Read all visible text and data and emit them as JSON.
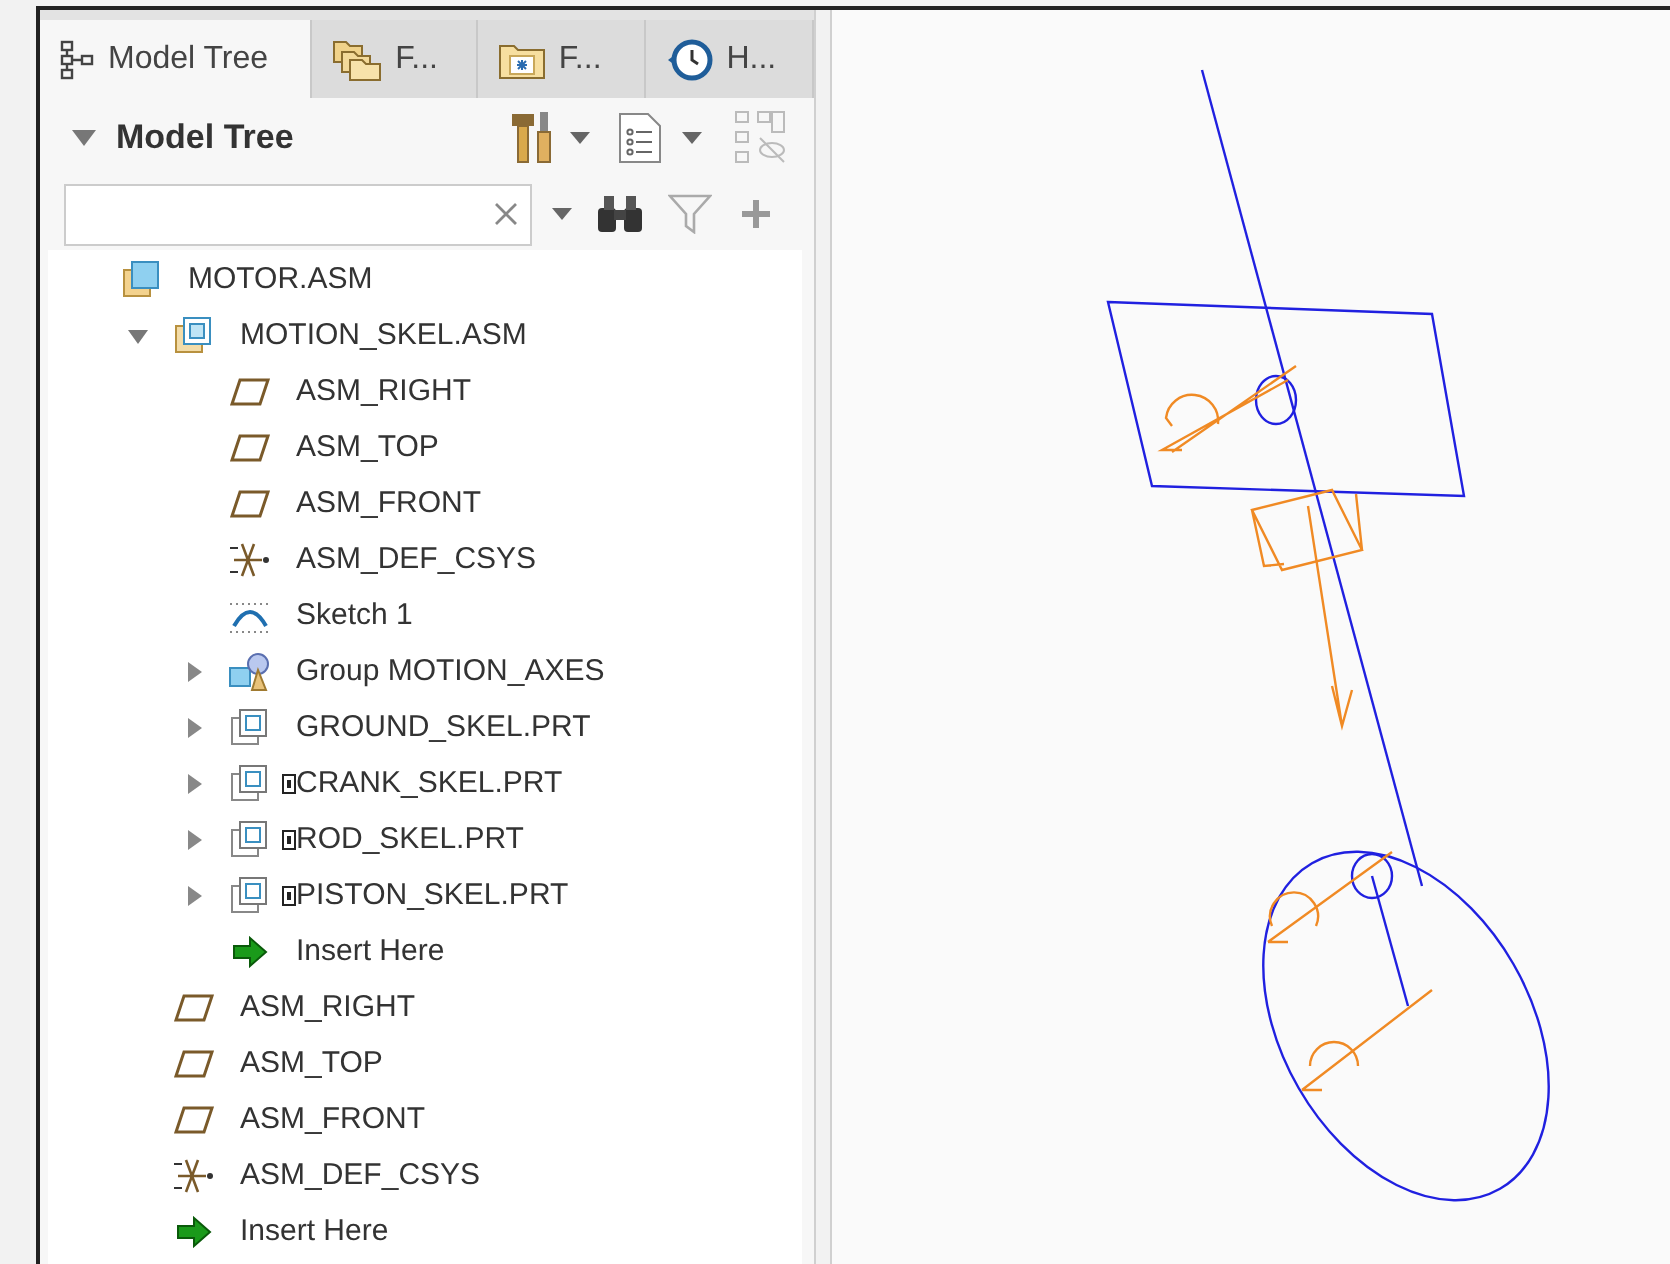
{
  "tabs": [
    {
      "label": "Model Tree",
      "kind": "tree",
      "selected": true
    },
    {
      "label": "F...",
      "kind": "folders",
      "selected": false
    },
    {
      "label": "F...",
      "kind": "favorites",
      "selected": false
    },
    {
      "label": "H...",
      "kind": "history",
      "selected": false
    }
  ],
  "panel": {
    "title": "Model Tree",
    "expanded": true
  },
  "tree": [
    {
      "label": "MOTOR.ASM",
      "kind": "assembly",
      "children": [
        {
          "label": "MOTION_SKEL.ASM",
          "kind": "skeleton",
          "expanded": true,
          "children": [
            {
              "label": "ASM_RIGHT",
              "kind": "plane"
            },
            {
              "label": "ASM_TOP",
              "kind": "plane"
            },
            {
              "label": "ASM_FRONT",
              "kind": "plane"
            },
            {
              "label": "ASM_DEF_CSYS",
              "kind": "csys"
            },
            {
              "label": "Sketch 1",
              "kind": "sketch"
            },
            {
              "label": "Group MOTION_AXES",
              "kind": "group",
              "expanded": false
            },
            {
              "label": "GROUND_SKEL.PRT",
              "kind": "part",
              "expanded": false,
              "flagged": false
            },
            {
              "label": "CRANK_SKEL.PRT",
              "kind": "part",
              "expanded": false,
              "flagged": true
            },
            {
              "label": "ROD_SKEL.PRT",
              "kind": "part",
              "expanded": false,
              "flagged": true
            },
            {
              "label": "PISTON_SKEL.PRT",
              "kind": "part",
              "expanded": false,
              "flagged": true
            },
            {
              "label": "Insert Here",
              "kind": "insert"
            }
          ]
        },
        {
          "label": "ASM_RIGHT",
          "kind": "plane"
        },
        {
          "label": "ASM_TOP",
          "kind": "plane"
        },
        {
          "label": "ASM_FRONT",
          "kind": "plane"
        },
        {
          "label": "ASM_DEF_CSYS",
          "kind": "csys"
        },
        {
          "label": "Insert Here",
          "kind": "insert"
        }
      ]
    }
  ],
  "viewport": {
    "kind": "mechanism"
  }
}
